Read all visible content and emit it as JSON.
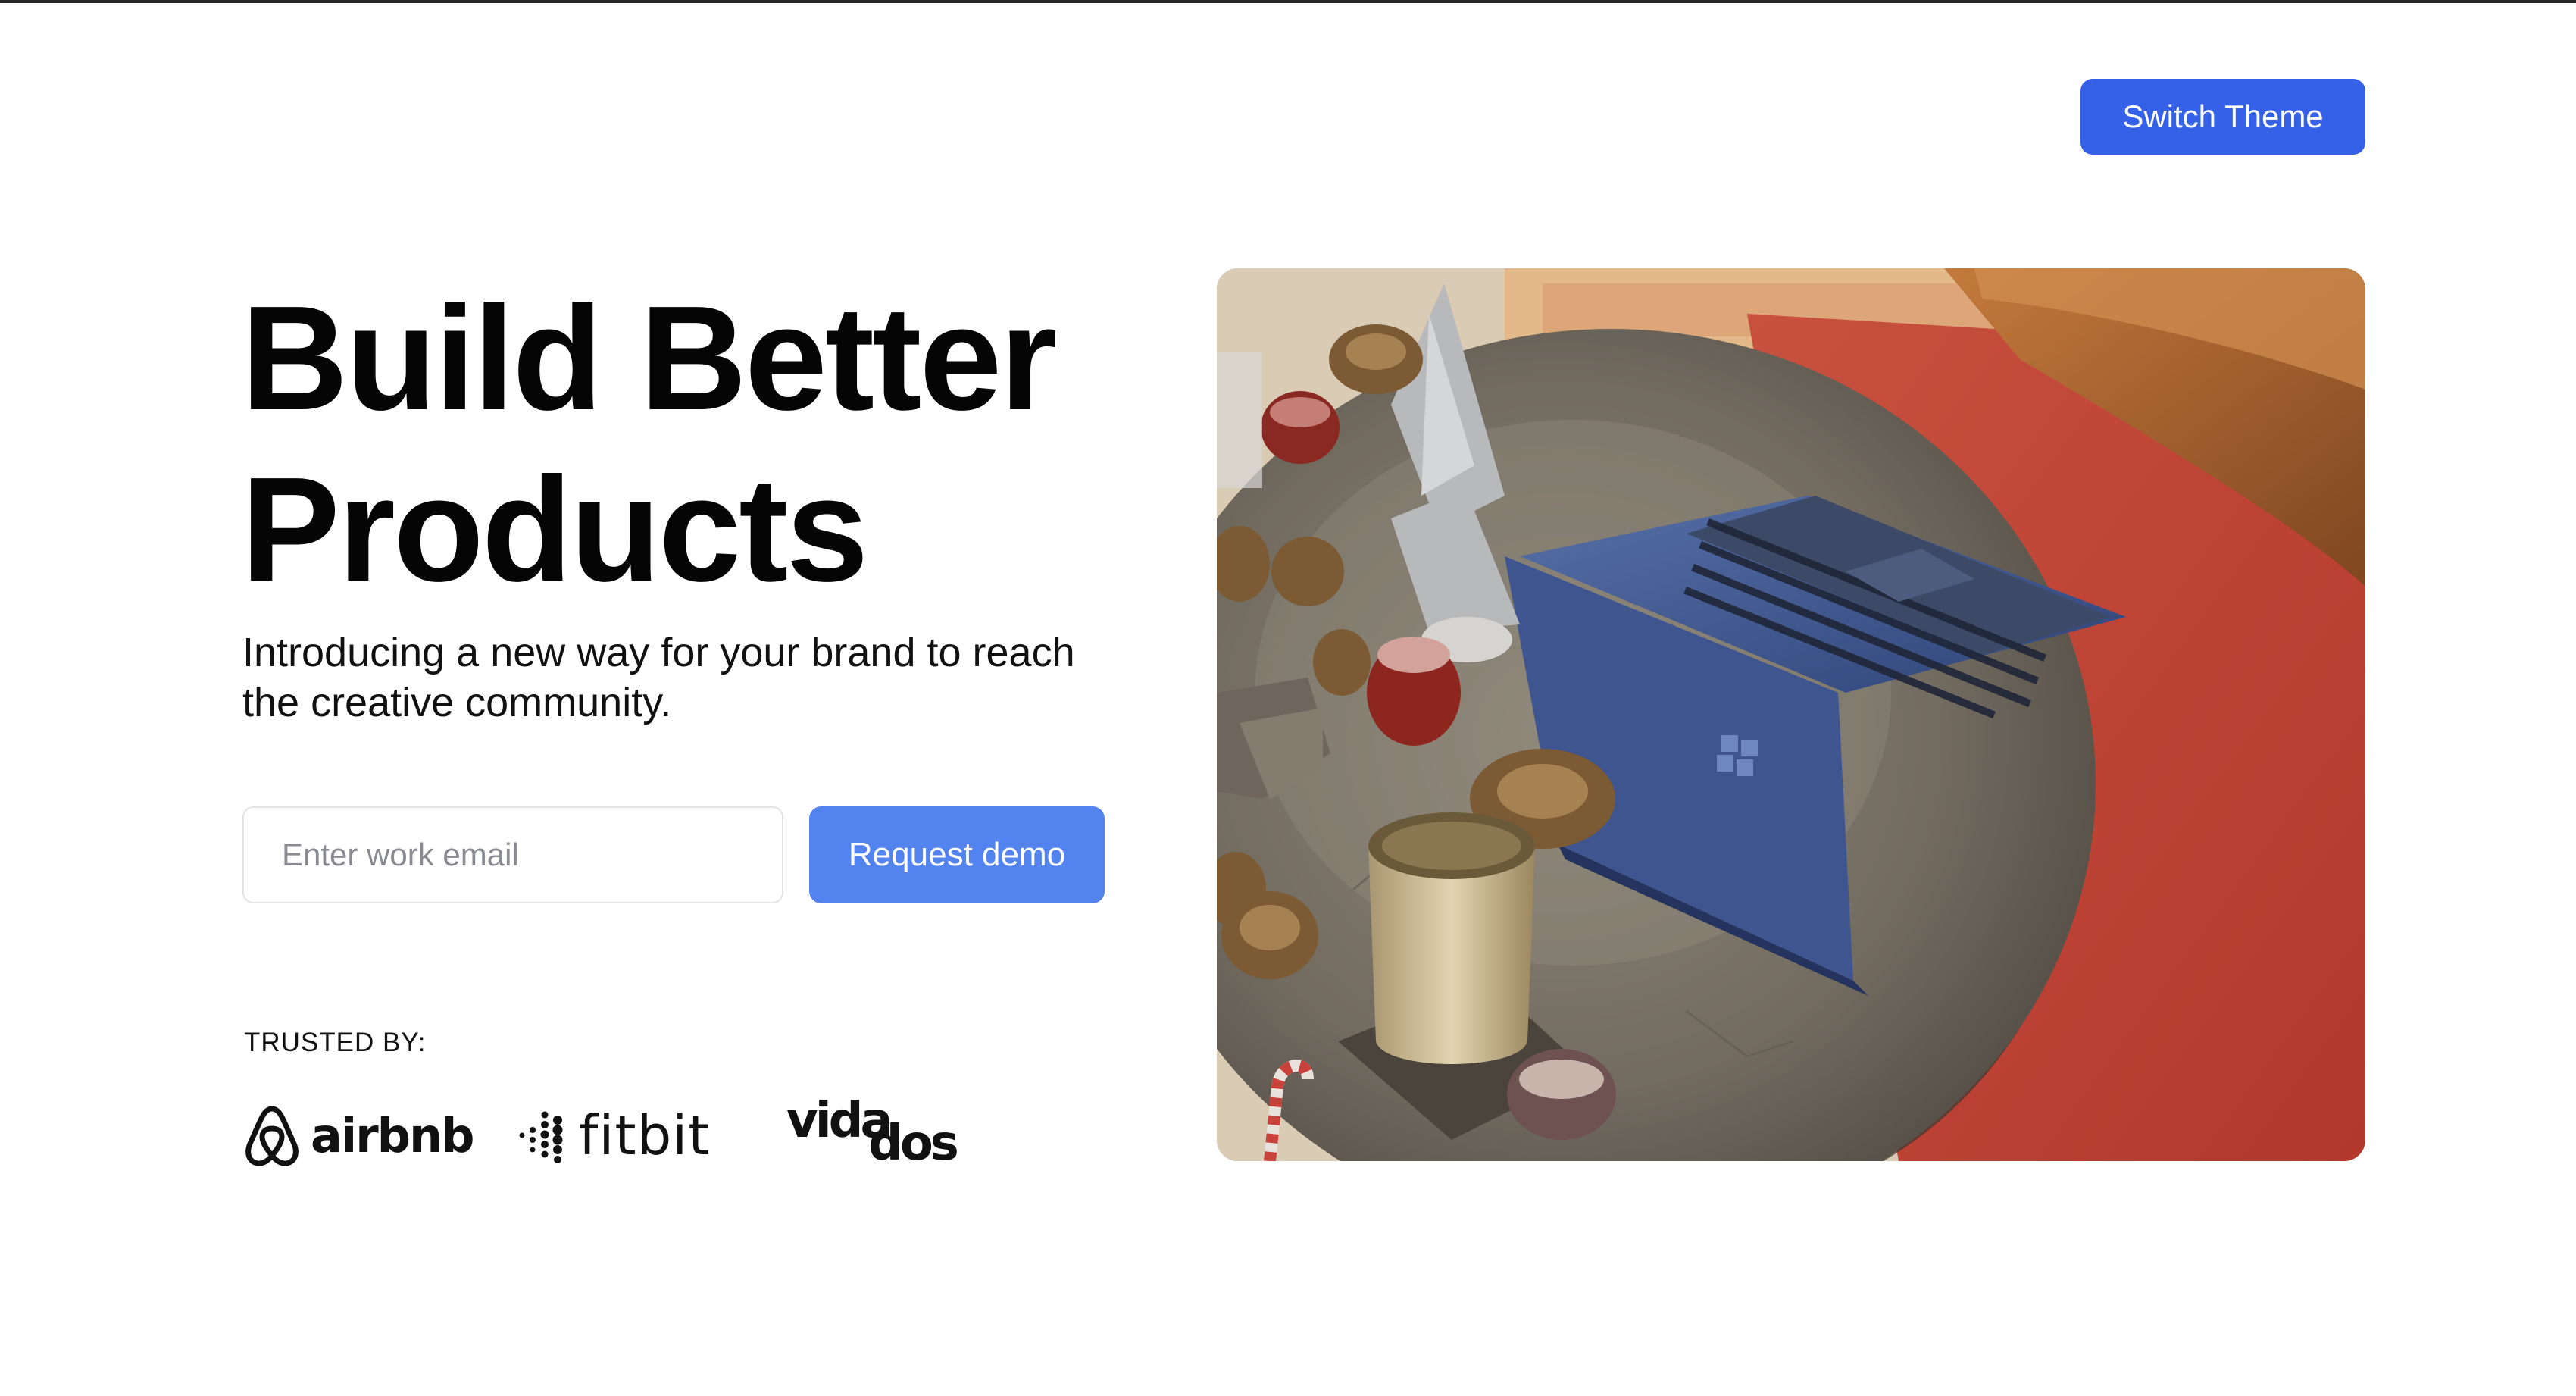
{
  "header": {
    "switch_theme_label": "Switch Theme"
  },
  "hero": {
    "title_line1": "Build Better",
    "title_line2": "Products",
    "subtitle": "Introducing a new way for your brand to reach the creative community.",
    "email_placeholder": "Enter work email",
    "email_value": "",
    "cta_label": "Request demo"
  },
  "trusted": {
    "label": "TRUSTED BY:",
    "logos": [
      {
        "name": "airbnb",
        "icon": "airbnb-belo-icon"
      },
      {
        "name": "fitbit",
        "icon": "fitbit-dots-icon"
      },
      {
        "name_part1": "vida",
        "name_part2": "dos"
      }
    ]
  },
  "colors": {
    "primary_button": "#3461e8",
    "cta_button": "#5283ee",
    "text": "#0b0b0b",
    "background": "#ffffff"
  }
}
